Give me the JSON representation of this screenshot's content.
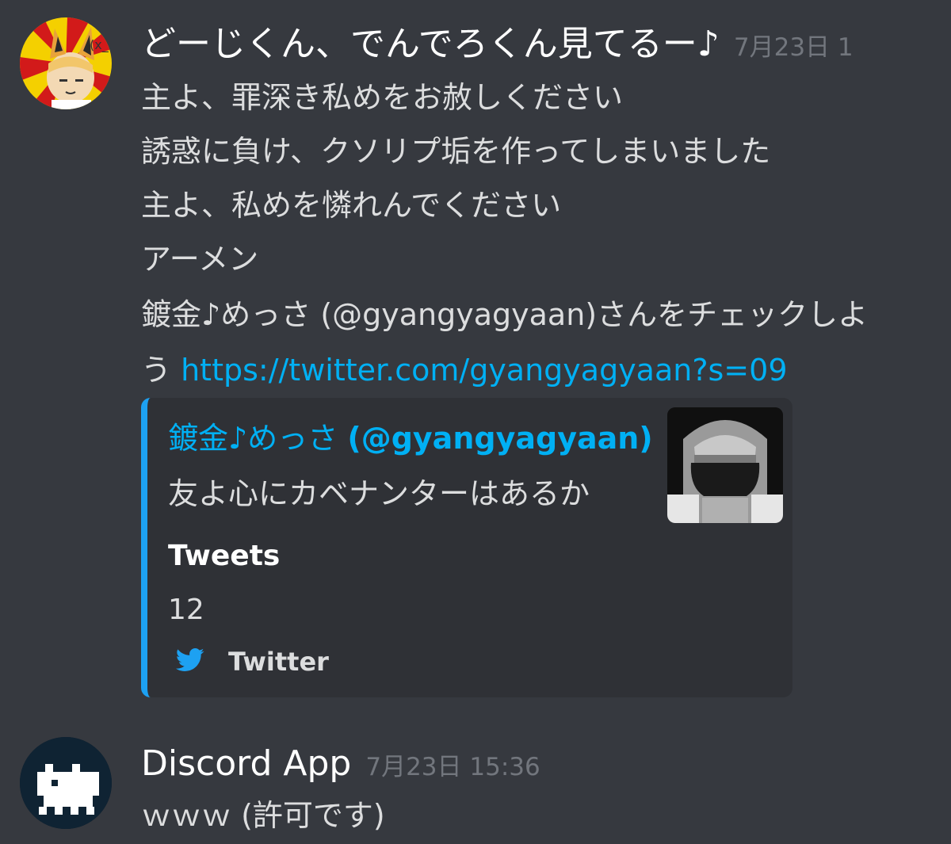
{
  "messages": [
    {
      "username": "どーじくん、でんでろくん見てるー♪",
      "timestamp": "7月23日 1",
      "lines": [
        "主よ、罪深き私めをお赦しください",
        "誘惑に負け、クソリプ垢を作ってしまいました",
        "主よ、私めを憐れんでください",
        "アーメン",
        "鍍金♪めっさ (@gyangyagyaan)さんをチェックしよ"
      ],
      "last_line_prefix": "う ",
      "link": "https://twitter.com/gyangyagyaan?s=09",
      "embed": {
        "author_name": "鍍金♪めっさ ",
        "author_handle": "(@gyangyagyaan)",
        "description": "友よ心にカベナンターはあるか",
        "field_name": "Tweets",
        "field_value": "12",
        "footer": "Twitter",
        "footer_icon": "twitter-bird-icon",
        "accent_color": "#1da1f2"
      }
    },
    {
      "username": "Discord App",
      "timestamp": "7月23日 15:36",
      "text": "ｗｗｗ (許可です)"
    }
  ]
}
